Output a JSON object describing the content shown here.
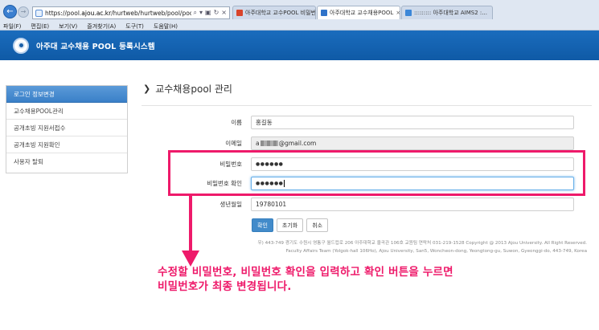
{
  "browser": {
    "url_prefix": "https://pool.",
    "url_host": "ajou.ac.kr",
    "url_path": "/hurtweb/hurtweb/pool/poolMemberPage.action",
    "tabs": [
      {
        "label": "아주대학교 교수POOL 비밀번...",
        "favicon_color": "#d9442b"
      },
      {
        "label": "아주대학교 교수채용POOL",
        "favicon_color": "#2f73c9"
      },
      {
        "label": "::::::::: 아주대학교 AIMS2 :...",
        "favicon_color": "#3c87d8"
      }
    ],
    "menu": [
      "파일(F)",
      "편집(E)",
      "보기(V)",
      "즐겨찾기(A)",
      "도구(T)",
      "도움말(H)"
    ]
  },
  "header": {
    "title": "아주대 교수채용 POOL 등록시스템"
  },
  "sidebar": {
    "items": [
      {
        "label": "로그인 정보변경",
        "active": true
      },
      {
        "label": "교수채용POOL관리",
        "active": false
      },
      {
        "label": "공개초빙 지원서접수",
        "active": false
      },
      {
        "label": "공개초빙 지원확인",
        "active": false
      },
      {
        "label": "사용자 탈퇴",
        "active": false
      }
    ]
  },
  "page": {
    "title": "교수채용pool 관리"
  },
  "form": {
    "name_label": "이름",
    "name_value": "홍길동",
    "email_label": "이메일",
    "email_prefix": "a",
    "email_suffix": "@gmail.com",
    "password_label": "비밀번호",
    "password_value": "●●●●●●",
    "password_confirm_label": "비밀번호 확인",
    "password_confirm_value": "●●●●●●",
    "birth_label": "생년월일",
    "birth_value": "19780101"
  },
  "buttons": {
    "confirm": "확인",
    "reset": "초기화",
    "cancel": "취소"
  },
  "footer": {
    "line1": "우) 443-749 경기도 수원시 영통구 월드컵로 206 아주대학교 율곡관 106호 교원팀 연락처 031-219-1528 Copyright @ 2013 Ajou University. All Right Reserved.",
    "line2": "Faculty Affairs Team (Yolgok-hall 106Ho), Ajou University, San5, Woncheon-dong, Yeongtong-gu, Suwon, Gyeonggi-do, 443-749, Korea"
  },
  "annotation": {
    "line1": "수정할 비밀번호, 비밀번호 확인을 입력하고 확인 버튼을 누르면",
    "line2": "비밀번호가 최종 변경됩니다.",
    "color": "#ee1a6a"
  },
  "icons": [
    "back-arrow-icon",
    "forward-arrow-icon",
    "site-icon",
    "search-icon",
    "refresh-icon",
    "close-icon",
    "logo-icon",
    "chevron-right-icon",
    "down-arrow-icon"
  ]
}
